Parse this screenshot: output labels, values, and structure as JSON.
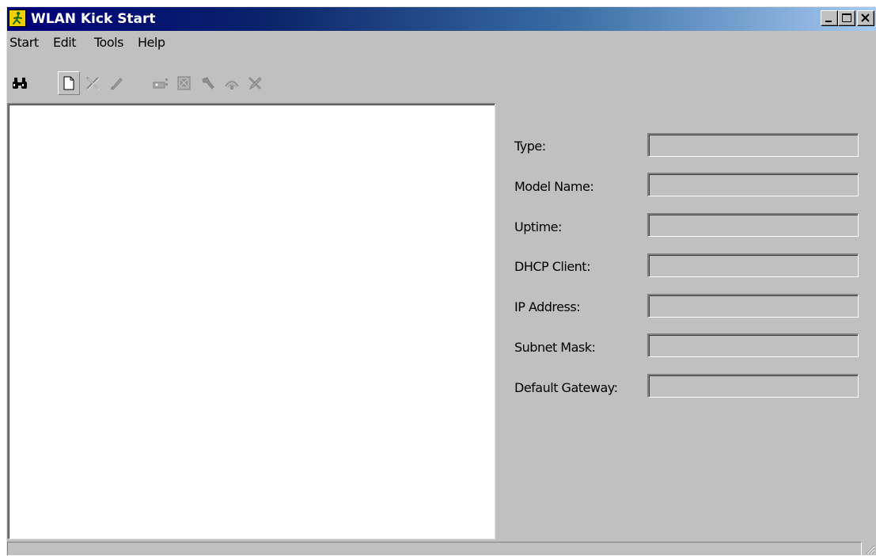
{
  "window": {
    "title": "WLAN Kick Start",
    "controls": {
      "minimize": "_",
      "maximize": "□",
      "close": "✕"
    }
  },
  "menu": {
    "items": [
      "Start",
      "Edit",
      "Tools",
      "Help"
    ]
  },
  "toolbar": {
    "buttons": [
      {
        "icon": "binoculars-icon",
        "enabled": true
      },
      {
        "icon": "new-document-icon",
        "enabled": true
      },
      {
        "icon": "delete-x-icon",
        "enabled": false
      },
      {
        "icon": "edit-pen-icon",
        "enabled": false
      },
      {
        "icon": "device-config-icon",
        "enabled": false
      },
      {
        "icon": "properties-icon",
        "enabled": false
      },
      {
        "icon": "wrench-icon",
        "enabled": false
      },
      {
        "icon": "wireless-icon",
        "enabled": false
      },
      {
        "icon": "tools-icon",
        "enabled": false
      }
    ]
  },
  "fields": [
    {
      "label": "Type:",
      "value": ""
    },
    {
      "label": "Model Name:",
      "value": ""
    },
    {
      "label": "Uptime:",
      "value": ""
    },
    {
      "label": "DHCP Client:",
      "value": ""
    },
    {
      "label": "IP Address:",
      "value": ""
    },
    {
      "label": "Subnet Mask:",
      "value": ""
    },
    {
      "label": "Default Gateway:",
      "value": ""
    }
  ],
  "statusbar": {
    "text": ""
  },
  "colors": {
    "face": "#c0c0c0",
    "titlebar_start": "#000078",
    "titlebar_end": "#a6caf0",
    "app_icon": "#f0d000"
  }
}
